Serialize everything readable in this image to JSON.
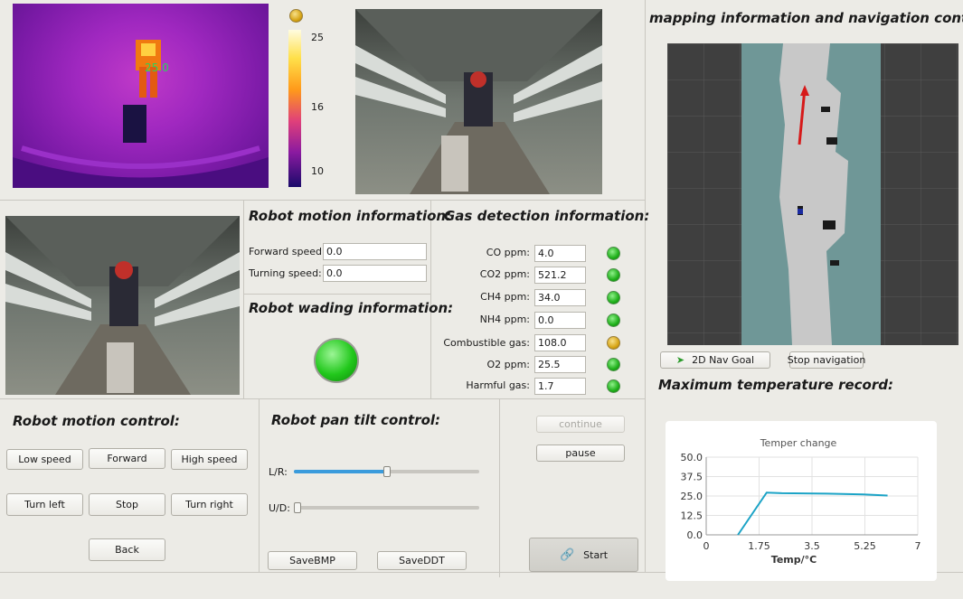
{
  "thermal": {
    "scale_labels": [
      "25",
      "16",
      "10"
    ],
    "overlay_value": "25.0"
  },
  "motion_info": {
    "heading": "Robot motion information:",
    "forward_label": "Forward speed:",
    "forward_value": "0.0",
    "turning_label": "Turning speed:",
    "turning_value": "0.0"
  },
  "wading": {
    "heading": "Robot wading information:"
  },
  "gas": {
    "heading": "Gas detection information:",
    "rows": [
      {
        "label": "CO ppm:",
        "value": "4.0",
        "status": "ok"
      },
      {
        "label": "CO2 ppm:",
        "value": "521.2",
        "status": "ok"
      },
      {
        "label": "CH4 ppm:",
        "value": "34.0",
        "status": "ok"
      },
      {
        "label": "NH4 ppm:",
        "value": "0.0",
        "status": "ok"
      },
      {
        "label": "Combustible gas:",
        "value": "108.0",
        "status": "warn"
      },
      {
        "label": "O2 ppm:",
        "value": "25.5",
        "status": "ok"
      },
      {
        "label": "Harmful gas:",
        "value": "1.7",
        "status": "ok"
      }
    ]
  },
  "mapping": {
    "heading": "mapping information and navigation control:",
    "nav_goal_label": "2D Nav Goal",
    "stop_nav_label": "Stop navigation"
  },
  "motion_control": {
    "heading": "Robot motion control:",
    "low_speed": "Low speed",
    "forward": "Forward",
    "high_speed": "High speed",
    "turn_left": "Turn left",
    "stop": "Stop",
    "turn_right": "Turn right",
    "back": "Back"
  },
  "pan_tilt": {
    "heading": "Robot pan tilt control:",
    "lr_label": "L/R:",
    "ud_label": "U/D:",
    "lr_level": 0.5,
    "ud_level": 0.0,
    "save_bmp": "SaveBMP",
    "save_ddt": "SaveDDT"
  },
  "actions": {
    "continue": "continue",
    "pause": "pause",
    "start": "Start"
  },
  "max_temp": {
    "heading": "Maximum temperature record:"
  },
  "colors": {
    "accent": "#3a9bdc",
    "led_ok": "#1fb01a",
    "led_warn": "#d7a516",
    "chart_line": "#1ba3c6"
  },
  "chart_data": {
    "type": "line",
    "title": "Temper change",
    "xlabel": "Temp/°C",
    "ylabel": "",
    "xlim": [
      0,
      7
    ],
    "ylim": [
      0,
      50
    ],
    "x_ticks": [
      "0",
      "1.75",
      "3.5",
      "5.25",
      "7"
    ],
    "y_ticks": [
      "50.0",
      "37.5",
      "25.0",
      "12.5",
      "0.0"
    ],
    "grid": true,
    "series": [
      {
        "x": [
          1.05,
          2.0,
          2.5,
          4.0,
          5.2,
          6.0
        ],
        "y": [
          0,
          27.2,
          26.8,
          26.5,
          26.0,
          25.3
        ]
      }
    ]
  }
}
